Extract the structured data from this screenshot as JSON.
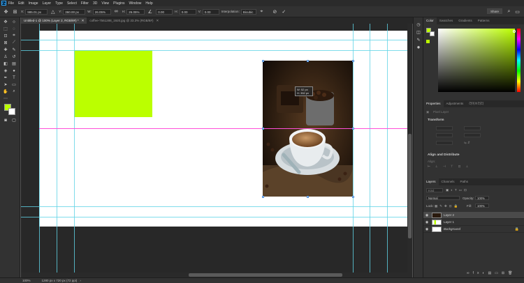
{
  "menubar": {
    "app_badge": "Ps",
    "items": [
      "File",
      "Edit",
      "Image",
      "Layer",
      "Type",
      "Select",
      "Filter",
      "3D",
      "View",
      "Plugins",
      "Window",
      "Help"
    ]
  },
  "options": {
    "x_label": "X:",
    "x_value": "985.01 px",
    "y_label": "Y:",
    "y_value": "360.00 px",
    "w_label": "W:",
    "w_value": "26.05%",
    "h_label": "H:",
    "h_value": "26.05%",
    "rotate_value": "0.00",
    "hskew_label": "H:",
    "hskew_value": "0.00",
    "vskew_label": "V:",
    "vskew_value": "0.00",
    "interp_label": "Interpolation:",
    "interp_value": "Bicubic",
    "share_label": "Share"
  },
  "tabs": [
    {
      "label": "Untitled-1 @ 100% (Layer 2, RGB/8#) *",
      "active": true
    },
    {
      "label": "coffee-7561288_1920.jpg @ 33.3% (RGB/8#)",
      "active": false
    }
  ],
  "canvas": {
    "tooltip_w": "W:  52 px",
    "tooltip_h": "H:  352 px",
    "colors": {
      "rect": "#bbff00",
      "guide": "#5fd3e6",
      "smart_guide": "#ff4fd8"
    }
  },
  "status": {
    "zoom": "100%",
    "doc_size": "1280 px x 720 px (72 ppi)"
  },
  "color_panel": {
    "tabs": [
      "Color",
      "Swatches",
      "Gradients",
      "Patterns"
    ],
    "foreground": "#bbff00",
    "background": "#ffffff"
  },
  "properties_panel": {
    "tabs": [
      "Properties",
      "Adjustments",
      "라이브러리"
    ],
    "layer_type": "Pixel Layer",
    "transform_title": "Transform",
    "align_title": "Align and Distribute",
    "align_label": "Align:"
  },
  "layers_panel": {
    "tabs": [
      "Layers",
      "Channels",
      "Paths"
    ],
    "filter_placeholder": "Kind",
    "blend_mode": "Normal",
    "opacity_label": "Opacity:",
    "opacity_value": "100%",
    "lock_label": "Lock:",
    "fill_label": "Fill:",
    "fill_value": "100%",
    "layers": [
      {
        "name": "Layer 2",
        "selected": true,
        "italic": false
      },
      {
        "name": "Layer 1",
        "selected": false,
        "italic": false
      },
      {
        "name": "Background",
        "selected": false,
        "italic": true
      }
    ]
  }
}
